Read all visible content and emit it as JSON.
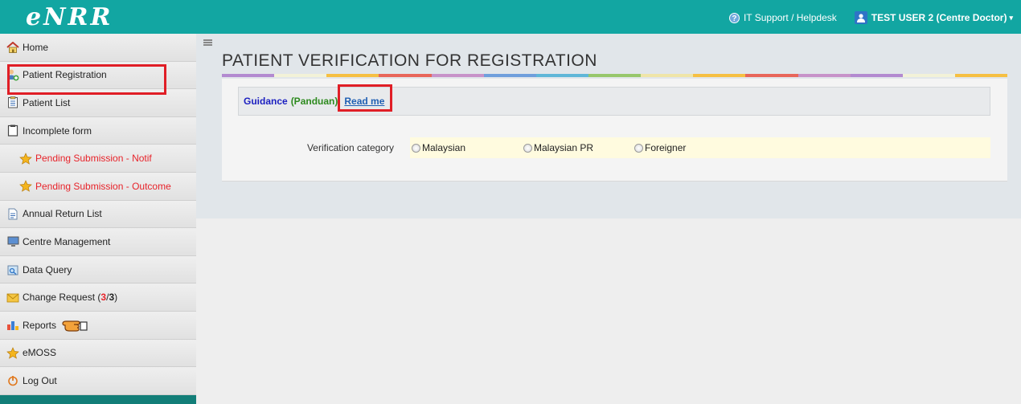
{
  "app": {
    "logo": "eNRR"
  },
  "header": {
    "helpdesk_label": "IT Support / Helpdesk",
    "user_label": "TEST USER 2 (Centre Doctor)",
    "caret": "▾"
  },
  "sidebar": {
    "items": [
      {
        "label": "Home",
        "icon": "home-icon"
      },
      {
        "label": "Patient Registration",
        "icon": "user-add-icon"
      },
      {
        "label": "Patient List",
        "icon": "list-icon"
      },
      {
        "label": "Incomplete form",
        "icon": "clipboard-icon"
      },
      {
        "label": "Pending Submission - Notif",
        "icon": "star-icon"
      },
      {
        "label": "Pending Submission - Outcome",
        "icon": "star-icon"
      },
      {
        "label": "Annual Return List",
        "icon": "document-icon"
      },
      {
        "label": "Centre Management",
        "icon": "monitor-icon"
      },
      {
        "label": "Data Query",
        "icon": "query-icon"
      },
      {
        "label": "Change Request (",
        "icon": "envelope-icon",
        "count_a": "3",
        "sep": " / ",
        "count_b": "3",
        "close": ")"
      },
      {
        "label": "Reports",
        "icon": "chart-icon"
      },
      {
        "label": "eMOSS",
        "icon": "star-icon"
      },
      {
        "label": "Log Out",
        "icon": "power-icon"
      }
    ]
  },
  "main": {
    "title": "PATIENT VERIFICATION FOR REGISTRATION",
    "guidance": {
      "label": "Guidance",
      "sub": "(Panduan)",
      "link": "Read me"
    },
    "verification": {
      "label": "Verification category",
      "options": [
        "Malaysian",
        "Malaysian PR",
        "Foreigner"
      ]
    }
  },
  "colors": {
    "topbar": "#12a6a2",
    "accent_red": "#e01e26",
    "rainbow": [
      "#b38ad0",
      "#f2f2d8",
      "#f6c043",
      "#e8665a",
      "#c793c9",
      "#6f9fdc",
      "#5fb7d8",
      "#97c76c",
      "#efe5a8",
      "#f6c043",
      "#e8665a",
      "#c793c9",
      "#b38ad0",
      "#f2f2d8",
      "#f6c043"
    ]
  }
}
